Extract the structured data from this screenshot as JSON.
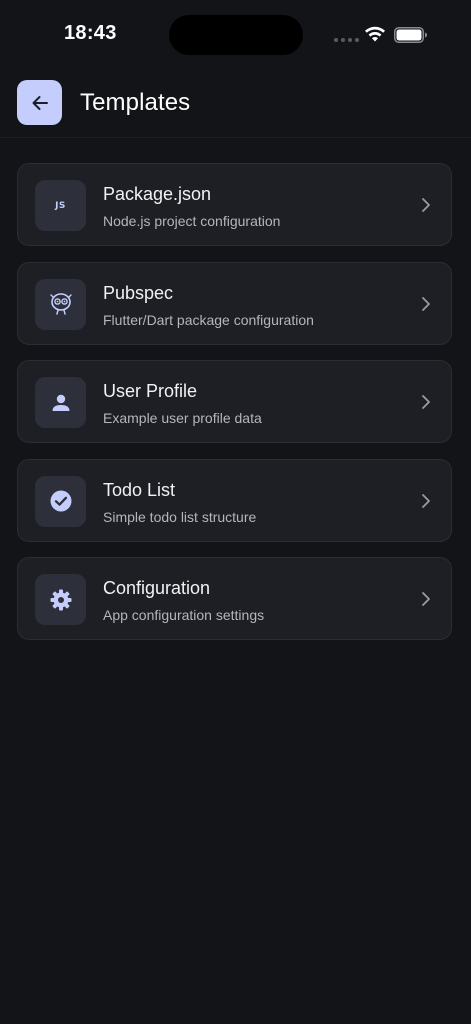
{
  "status_bar": {
    "time": "18:43"
  },
  "header": {
    "title": "Templates",
    "back_icon": "arrow-left-icon"
  },
  "colors": {
    "background": "#131418",
    "card": "#1e1f24",
    "accent": "#c5cdfd",
    "icon_tile": "#2d2f3a"
  },
  "templates": [
    {
      "title": "Package.json",
      "subtitle": "Node.js project configuration",
      "icon": "js-icon",
      "icon_text": "JS"
    },
    {
      "title": "Pubspec",
      "subtitle": "Flutter/Dart package configuration",
      "icon": "dart-mascot-icon"
    },
    {
      "title": "User Profile",
      "subtitle": "Example user profile data",
      "icon": "person-icon"
    },
    {
      "title": "Todo List",
      "subtitle": "Simple todo list structure",
      "icon": "check-circle-icon"
    },
    {
      "title": "Configuration",
      "subtitle": "App configuration settings",
      "icon": "gear-icon"
    }
  ]
}
